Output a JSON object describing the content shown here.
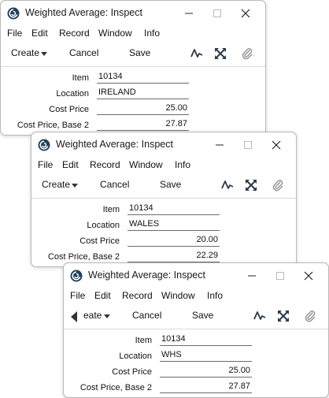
{
  "windows": [
    {
      "title": "Weighted Average: Inspect",
      "menu": [
        "File",
        "Edit",
        "Record",
        "Window",
        "Info"
      ],
      "toolbar": {
        "create_label": "Create",
        "cancel_label": "Cancel",
        "save_label": "Save"
      },
      "fields": [
        {
          "label": "Item",
          "value": "10134",
          "align": "left"
        },
        {
          "label": "Location",
          "value": "IRELAND",
          "align": "left"
        },
        {
          "label": "Cost Price",
          "value": "25.00",
          "align": "right"
        },
        {
          "label": "Cost Price, Base 2",
          "value": "27.87",
          "align": "right"
        }
      ]
    },
    {
      "title": "Weighted Average: Inspect",
      "menu": [
        "File",
        "Edit",
        "Record",
        "Window",
        "Info"
      ],
      "toolbar": {
        "create_label": "Create",
        "cancel_label": "Cancel",
        "save_label": "Save"
      },
      "fields": [
        {
          "label": "Item",
          "value": "10134",
          "align": "left"
        },
        {
          "label": "Location",
          "value": "WALES",
          "align": "left"
        },
        {
          "label": "Cost Price",
          "value": "20.00",
          "align": "right"
        },
        {
          "label": "Cost Price, Base 2",
          "value": "22.29",
          "align": "right"
        }
      ]
    },
    {
      "title": "Weighted Average: Inspect",
      "menu": [
        "File",
        "Edit",
        "Record",
        "Window",
        "Info"
      ],
      "toolbar": {
        "create_label": "eate",
        "cancel_label": "Cancel",
        "save_label": "Save"
      },
      "fields": [
        {
          "label": "Item",
          "value": "10134",
          "align": "left"
        },
        {
          "label": "Location",
          "value": "WHS",
          "align": "left"
        },
        {
          "label": "Cost Price",
          "value": "25.00",
          "align": "right"
        },
        {
          "label": "Cost Price, Base 2",
          "value": "27.87",
          "align": "right"
        }
      ]
    }
  ],
  "icons": {
    "app": "hansaworld-swirl-icon",
    "minimize": "minimize-icon",
    "maximize": "maximize-icon",
    "close": "close-icon",
    "create_dropdown": "chevron-down-icon",
    "pulse": "activity-pulse-icon",
    "expand": "expand-arrows-icon",
    "attach": "paperclip-icon",
    "back": "back-arrow-icon"
  },
  "colors": {
    "window_bg": "#ffffff",
    "border": "#b9b9b9",
    "text": "#111111",
    "icon": "#2b3a4a"
  }
}
